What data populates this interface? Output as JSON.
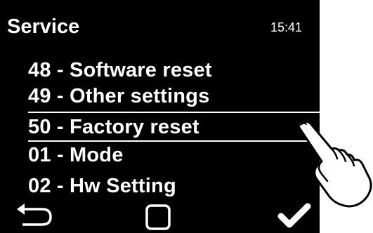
{
  "screen": {
    "title": "Service",
    "clock": "15:41"
  },
  "menu": {
    "items": [
      {
        "label": "48 - Software reset"
      },
      {
        "label": "49 - Other settings"
      },
      {
        "label": "50 - Factory reset",
        "selected": true
      },
      {
        "label": "01 - Mode"
      },
      {
        "label": "02 - Hw Setting"
      }
    ]
  },
  "softkeys": {
    "back": "back-arrow-icon",
    "home": "square-icon",
    "confirm": "checkmark-icon"
  },
  "overlay": {
    "icon": "pointing-hand-icon"
  },
  "colors": {
    "screen_bg": "#000000",
    "text": "#ffffff",
    "page_bg": "#ffffff"
  }
}
